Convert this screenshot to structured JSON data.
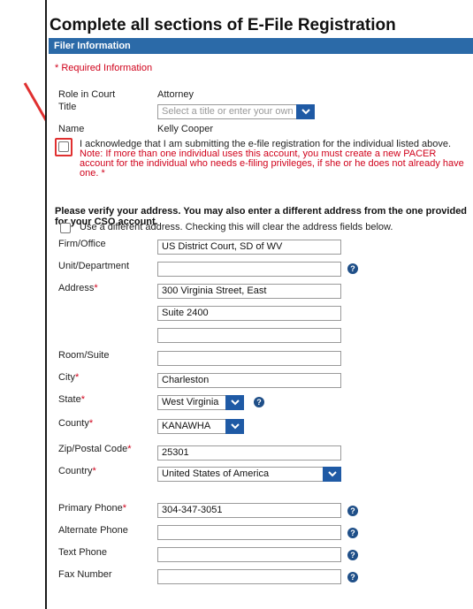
{
  "page": {
    "title": "Complete all sections of E-File Registration",
    "section": "Filer Information",
    "required_info": "* Required Information"
  },
  "filer": {
    "role_label": "Role in Court",
    "role_value": "Attorney",
    "title_label": "Title",
    "title_placeholder": "Select a title or enter your own",
    "name_label": "Name",
    "name_value": "Kelly Cooper"
  },
  "acknowledgement": {
    "text": "I acknowledge that I am submitting the e-file registration for the individual listed above.",
    "note": "Note: If more than one individual uses this account, you must create a new PACER account for the individual who needs e-filing privileges, if she or he does not already have one. *",
    "checked": false
  },
  "address_section": {
    "verify_text": "Please verify your address. You may also enter a different address from the one provided for your CSO account.",
    "different_address_label": "Use a different address. Checking this will clear the address fields below.",
    "firm_label": "Firm/Office",
    "firm_value": "US District Court, SD of WV",
    "unit_label": "Unit/Department",
    "unit_value": "",
    "address_label": "Address",
    "address_line1": "300 Virginia Street, East",
    "address_line2": "Suite 2400",
    "address_line3": "",
    "room_label": "Room/Suite",
    "room_value": "",
    "city_label": "City",
    "city_value": "Charleston",
    "state_label": "State",
    "state_value": "West Virginia",
    "county_label": "County",
    "county_value": "KANAWHA",
    "zip_label": "Zip/Postal Code",
    "zip_value": "25301",
    "country_label": "Country",
    "country_value": "United States of America",
    "primary_phone_label": "Primary Phone",
    "primary_phone_value": "304-347-3051",
    "alt_phone_label": "Alternate Phone",
    "alt_phone_value": "",
    "text_phone_label": "Text Phone",
    "text_phone_value": "",
    "fax_label": "Fax Number",
    "fax_value": ""
  },
  "required_star": "*",
  "help_glyph": "?",
  "colors": {
    "accent": "#2b6aa8",
    "required": "#d0021b",
    "annotation": "#e03030",
    "help": "#1f4f88"
  }
}
